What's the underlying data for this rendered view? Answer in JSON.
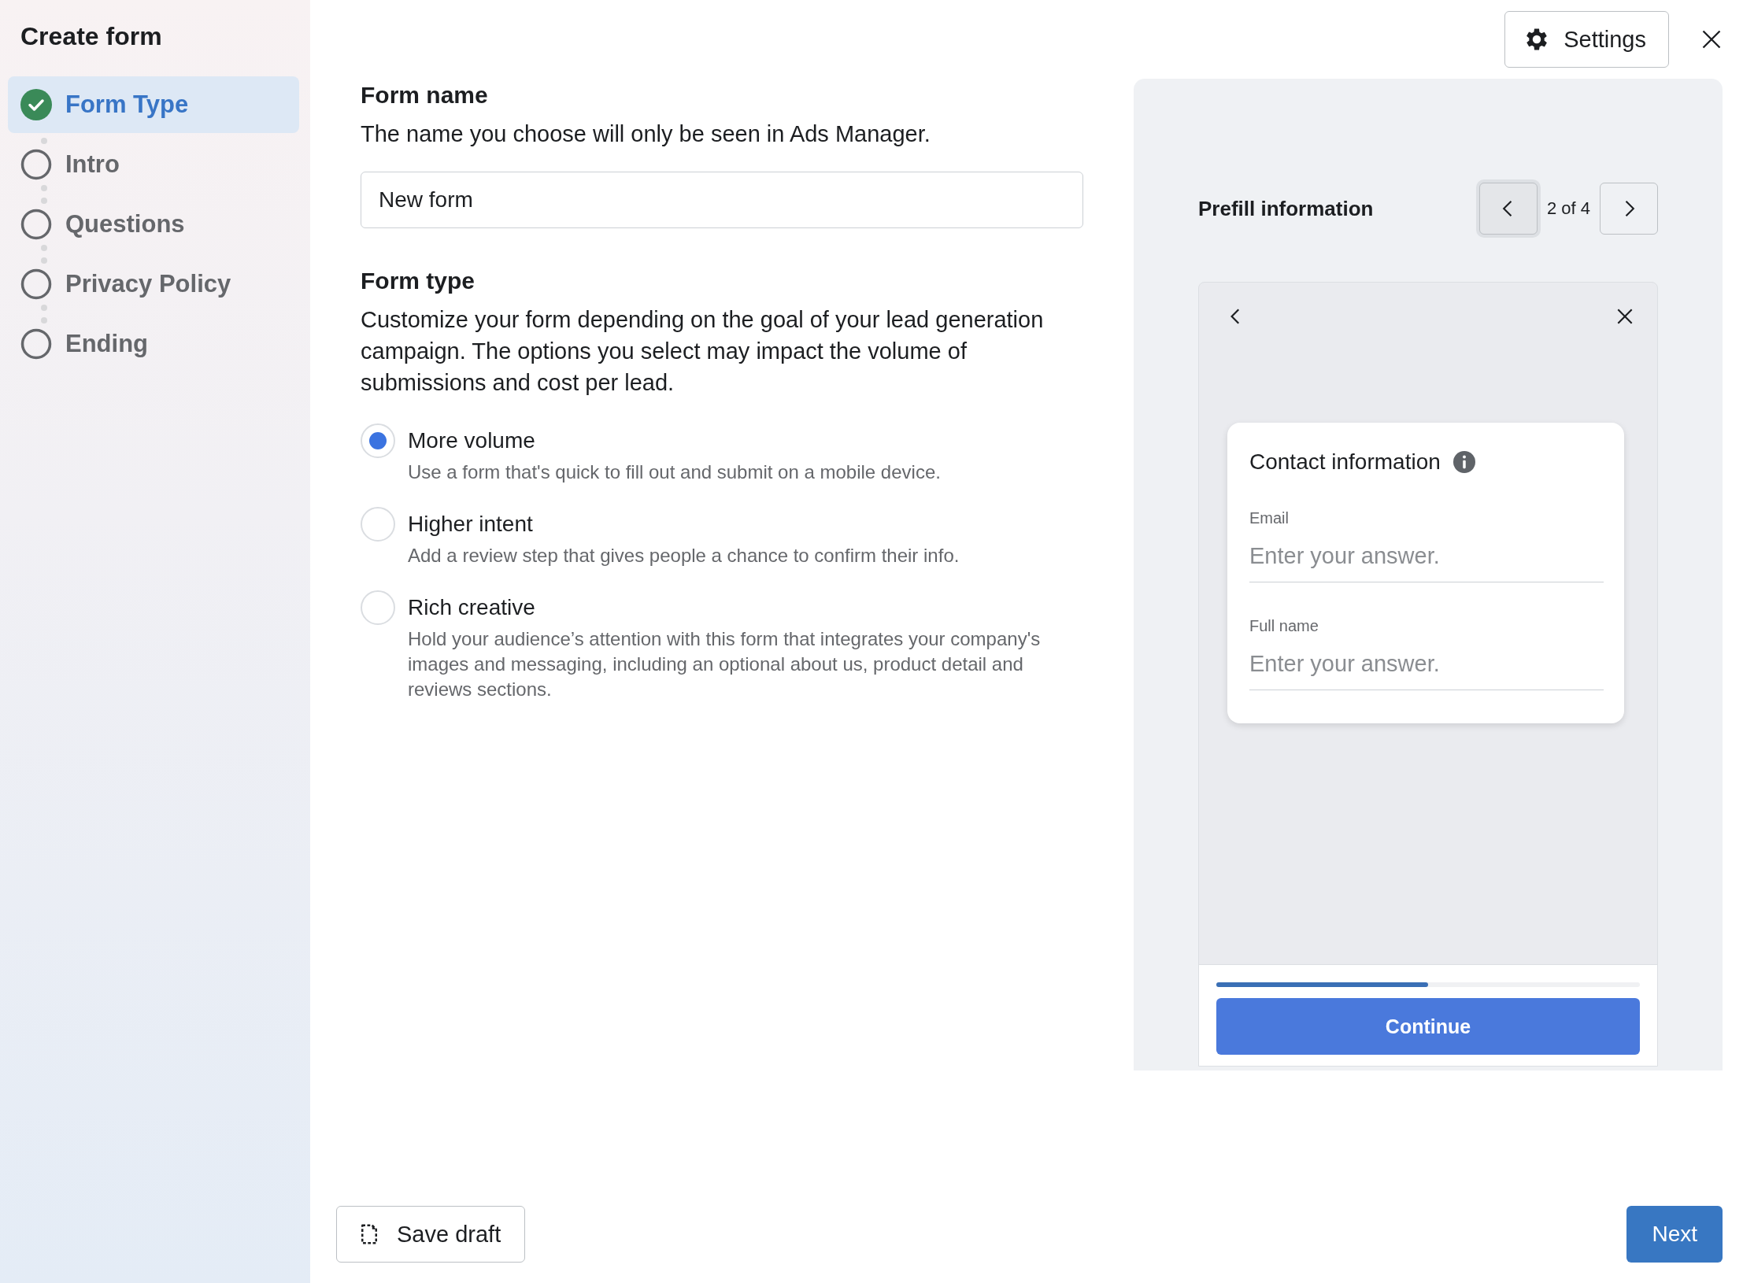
{
  "sidebar": {
    "title": "Create form",
    "steps": [
      {
        "label": "Form Type",
        "done": true,
        "selected": true
      },
      {
        "label": "Intro",
        "done": false,
        "selected": false
      },
      {
        "label": "Questions",
        "done": false,
        "selected": false
      },
      {
        "label": "Privacy Policy",
        "done": false,
        "selected": false
      },
      {
        "label": "Ending",
        "done": false,
        "selected": false
      }
    ]
  },
  "header": {
    "settings_button": "Settings"
  },
  "form_name": {
    "heading": "Form name",
    "description": "The name you choose will only be seen in Ads Manager.",
    "value": "New form"
  },
  "form_type": {
    "heading": "Form type",
    "description": "Customize your form depending on the goal of your lead generation campaign. The options you select may impact the volume of submissions and cost per lead.",
    "options": [
      {
        "label": "More volume",
        "description": "Use a form that's quick to fill out and submit on a mobile device.",
        "selected": true
      },
      {
        "label": "Higher intent",
        "description": "Add a review step that gives people a chance to confirm their info.",
        "selected": false
      },
      {
        "label": "Rich creative",
        "description": "Hold your audience’s attention with this form that integrates your company's images and messaging, including an optional about us, product detail and reviews sections.",
        "selected": false
      }
    ]
  },
  "preview": {
    "title": "Prefill information",
    "counter": "2 of 4",
    "card_title": "Contact information",
    "fields": [
      {
        "label": "Email",
        "placeholder": "Enter your answer."
      },
      {
        "label": "Full name",
        "placeholder": "Enter your answer."
      }
    ],
    "progress": {
      "level": 0.5
    },
    "continue_button": "Continue"
  },
  "footer": {
    "save_button": "Save draft",
    "next_button": "Next"
  }
}
